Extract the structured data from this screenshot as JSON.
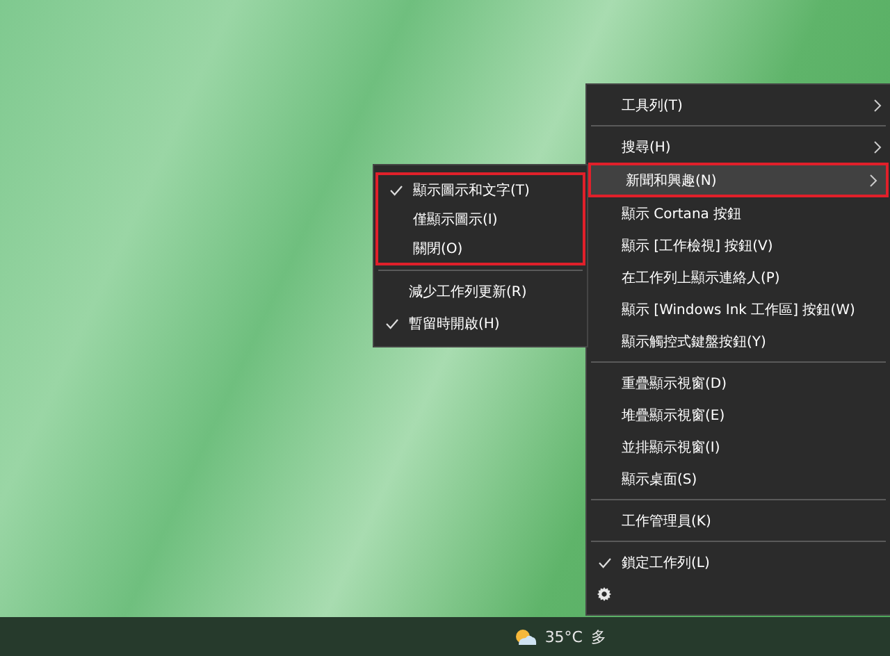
{
  "context_menu": {
    "items": [
      {
        "kind": "item",
        "label": "工具列(T)",
        "submenu": true,
        "checked": false,
        "selected": false,
        "annotated": false
      },
      {
        "kind": "separator"
      },
      {
        "kind": "item",
        "label": "搜尋(H)",
        "submenu": true,
        "checked": false,
        "selected": false,
        "annotated": false
      },
      {
        "kind": "item",
        "label": "新聞和興趣(N)",
        "submenu": true,
        "checked": false,
        "selected": true,
        "annotated": true
      },
      {
        "kind": "item",
        "label": "顯示 Cortana 按鈕",
        "submenu": false,
        "checked": false,
        "selected": false,
        "annotated": false
      },
      {
        "kind": "item",
        "label": "顯示 [工作檢視] 按鈕(V)",
        "submenu": false,
        "checked": false,
        "selected": false,
        "annotated": false
      },
      {
        "kind": "item",
        "label": "在工作列上顯示連絡人(P)",
        "submenu": false,
        "checked": false,
        "selected": false,
        "annotated": false
      },
      {
        "kind": "item",
        "label": "顯示 [Windows Ink 工作區] 按鈕(W)",
        "submenu": false,
        "checked": false,
        "selected": false,
        "annotated": false
      },
      {
        "kind": "item",
        "label": "顯示觸控式鍵盤按鈕(Y)",
        "submenu": false,
        "checked": false,
        "selected": false,
        "annotated": false
      },
      {
        "kind": "separator"
      },
      {
        "kind": "item",
        "label": "重疊顯示視窗(D)",
        "submenu": false,
        "checked": false,
        "selected": false,
        "annotated": false
      },
      {
        "kind": "item",
        "label": "堆疊顯示視窗(E)",
        "submenu": false,
        "checked": false,
        "selected": false,
        "annotated": false
      },
      {
        "kind": "item",
        "label": "並排顯示視窗(I)",
        "submenu": false,
        "checked": false,
        "selected": false,
        "annotated": false
      },
      {
        "kind": "item",
        "label": "顯示桌面(S)",
        "submenu": false,
        "checked": false,
        "selected": false,
        "annotated": false
      },
      {
        "kind": "separator"
      },
      {
        "kind": "item",
        "label": "工作管理員(K)",
        "submenu": false,
        "checked": false,
        "selected": false,
        "annotated": false
      },
      {
        "kind": "separator"
      },
      {
        "kind": "item",
        "label": "鎖定工作列(L)",
        "submenu": false,
        "checked": true,
        "selected": false,
        "annotated": false
      },
      {
        "kind": "settings"
      }
    ]
  },
  "submenu": {
    "items": [
      {
        "kind": "item",
        "label": "顯示圖示和文字(T)",
        "submenu": false,
        "checked": true,
        "selected": false,
        "annotated": true
      },
      {
        "kind": "item",
        "label": "僅顯示圖示(I)",
        "submenu": false,
        "checked": false,
        "selected": false,
        "annotated": true
      },
      {
        "kind": "item",
        "label": "關閉(O)",
        "submenu": false,
        "checked": false,
        "selected": false,
        "annotated": true
      },
      {
        "kind": "separator"
      },
      {
        "kind": "item",
        "label": "減少工作列更新(R)",
        "submenu": false,
        "checked": false,
        "selected": false,
        "annotated": false
      },
      {
        "kind": "item",
        "label": "暫留時開啟(H)",
        "submenu": false,
        "checked": true,
        "selected": false,
        "annotated": false
      }
    ]
  },
  "taskbar": {
    "weather": {
      "temperature": "35°C",
      "condition": "多"
    }
  }
}
